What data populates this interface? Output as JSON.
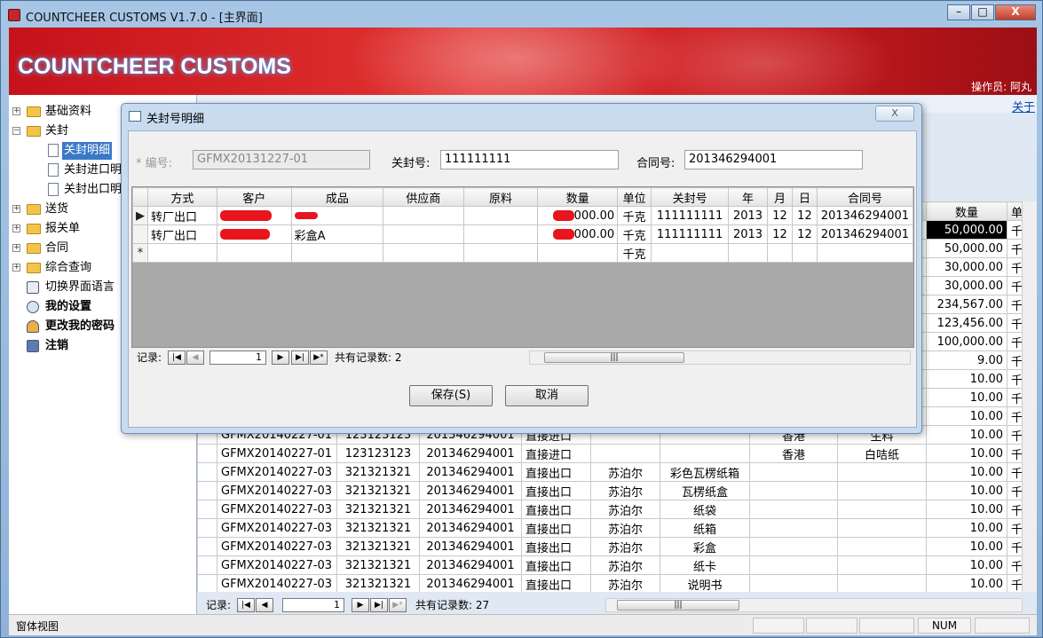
{
  "window": {
    "title": "COUNTCHEER CUSTOMS V1.7.0 - [主界面]",
    "buttons": {
      "minimize": "–",
      "maximize": "□",
      "close": "X"
    }
  },
  "banner": {
    "brand": "COUNTCHEER CUSTOMS",
    "operator": "操作员: 阿丸"
  },
  "nav": {
    "items": [
      {
        "label": "基础资料",
        "expander": "+"
      },
      {
        "label": "关封",
        "expander": "−"
      },
      {
        "label": "关封明细"
      },
      {
        "label": "关封进口明"
      },
      {
        "label": "关封出口明"
      },
      {
        "label": "送货",
        "expander": "+"
      },
      {
        "label": "报关单",
        "expander": "+"
      },
      {
        "label": "合同",
        "expander": "+"
      },
      {
        "label": "综合查询",
        "expander": "+"
      },
      {
        "label": "切换界面语言"
      },
      {
        "label": "我的设置"
      },
      {
        "label": "更改我的密码"
      },
      {
        "label": "注销"
      }
    ]
  },
  "tabs": {
    "about": "关于"
  },
  "main_grid": {
    "headers": {
      "qty": "数量",
      "unit": "单"
    },
    "top_rows": [
      {
        "qty": "50,000.00",
        "unit": "千"
      },
      {
        "qty": "50,000.00",
        "unit": "千"
      },
      {
        "qty": "30,000.00",
        "unit": "千"
      },
      {
        "qty": "30,000.00",
        "unit": "千"
      },
      {
        "qty": "234,567.00",
        "unit": "千"
      },
      {
        "qty": "123,456.00",
        "unit": "千"
      },
      {
        "qty": "100,000.00",
        "unit": "千"
      },
      {
        "qty": "9.00",
        "unit": "千"
      },
      {
        "qty": "10.00",
        "unit": "千"
      },
      {
        "qty": "10.00",
        "unit": "千"
      },
      {
        "qty": "10.00",
        "unit": "千"
      }
    ],
    "rows": [
      {
        "id": "GFMX20140227-01",
        "seal": "123123123",
        "contract": "201346294001",
        "mode": "直接进口",
        "supplier": "",
        "product": "",
        "origin": "香港",
        "material": "生料",
        "qty": "10.00",
        "unit": "千"
      },
      {
        "id": "GFMX20140227-01",
        "seal": "123123123",
        "contract": "201346294001",
        "mode": "直接进口",
        "supplier": "",
        "product": "",
        "origin": "香港",
        "material": "白咭纸",
        "qty": "10.00",
        "unit": "千"
      },
      {
        "id": "GFMX20140227-03",
        "seal": "321321321",
        "contract": "201346294001",
        "mode": "直接出口",
        "supplier": "苏泊尔",
        "product": "彩色瓦楞纸箱",
        "origin": "",
        "material": "",
        "qty": "10.00",
        "unit": "千"
      },
      {
        "id": "GFMX20140227-03",
        "seal": "321321321",
        "contract": "201346294001",
        "mode": "直接出口",
        "supplier": "苏泊尔",
        "product": "瓦楞纸盒",
        "origin": "",
        "material": "",
        "qty": "10.00",
        "unit": "千"
      },
      {
        "id": "GFMX20140227-03",
        "seal": "321321321",
        "contract": "201346294001",
        "mode": "直接出口",
        "supplier": "苏泊尔",
        "product": "纸袋",
        "origin": "",
        "material": "",
        "qty": "10.00",
        "unit": "千"
      },
      {
        "id": "GFMX20140227-03",
        "seal": "321321321",
        "contract": "201346294001",
        "mode": "直接出口",
        "supplier": "苏泊尔",
        "product": "纸箱",
        "origin": "",
        "material": "",
        "qty": "10.00",
        "unit": "千"
      },
      {
        "id": "GFMX20140227-03",
        "seal": "321321321",
        "contract": "201346294001",
        "mode": "直接出口",
        "supplier": "苏泊尔",
        "product": "彩盒",
        "origin": "",
        "material": "",
        "qty": "10.00",
        "unit": "千"
      },
      {
        "id": "GFMX20140227-03",
        "seal": "321321321",
        "contract": "201346294001",
        "mode": "直接出口",
        "supplier": "苏泊尔",
        "product": "纸卡",
        "origin": "",
        "material": "",
        "qty": "10.00",
        "unit": "千"
      },
      {
        "id": "GFMX20140227-03",
        "seal": "321321321",
        "contract": "201346294001",
        "mode": "直接出口",
        "supplier": "苏泊尔",
        "product": "说明书",
        "origin": "",
        "material": "",
        "qty": "10.00",
        "unit": "千"
      }
    ],
    "nav": {
      "label": "记录:",
      "current": "1",
      "total": "共有记录数: 27"
    }
  },
  "dialog": {
    "title": "关封号明细",
    "close": "X",
    "fields": {
      "code_label": "* 编号:",
      "code_value": "GFMX20131227-01",
      "seal_label": "关封号:",
      "seal_value": "111111111",
      "contract_label": "合同号:",
      "contract_value": "201346294001"
    },
    "grid": {
      "headers": [
        "方式",
        "客户",
        "成品",
        "供应商",
        "原料",
        "数量",
        "单位",
        "关封号",
        "年",
        "月",
        "日",
        "合同号"
      ],
      "rows": [
        {
          "selector": "▶",
          "mode": "转厂出口",
          "customer": "",
          "product": "纸箱",
          "supplier": "",
          "material": "",
          "qty": "000.00",
          "unit": "千克",
          "seal": "111111111",
          "year": "2013",
          "month": "12",
          "day": "12",
          "contract": "201346294001"
        },
        {
          "selector": "",
          "mode": "转厂出口",
          "customer": "",
          "product": "彩盒A",
          "supplier": "",
          "material": "",
          "qty": "000.00",
          "unit": "千克",
          "seal": "111111111",
          "year": "2013",
          "month": "12",
          "day": "12",
          "contract": "201346294001"
        }
      ],
      "new_row": {
        "selector": "*",
        "unit": "千克"
      },
      "nav": {
        "label": "记录:",
        "current": "1",
        "total": "共有记录数: 2"
      }
    },
    "buttons": {
      "save": "保存(S)",
      "cancel": "取消"
    }
  },
  "status": {
    "text": "窗体视图",
    "num": "NUM"
  }
}
